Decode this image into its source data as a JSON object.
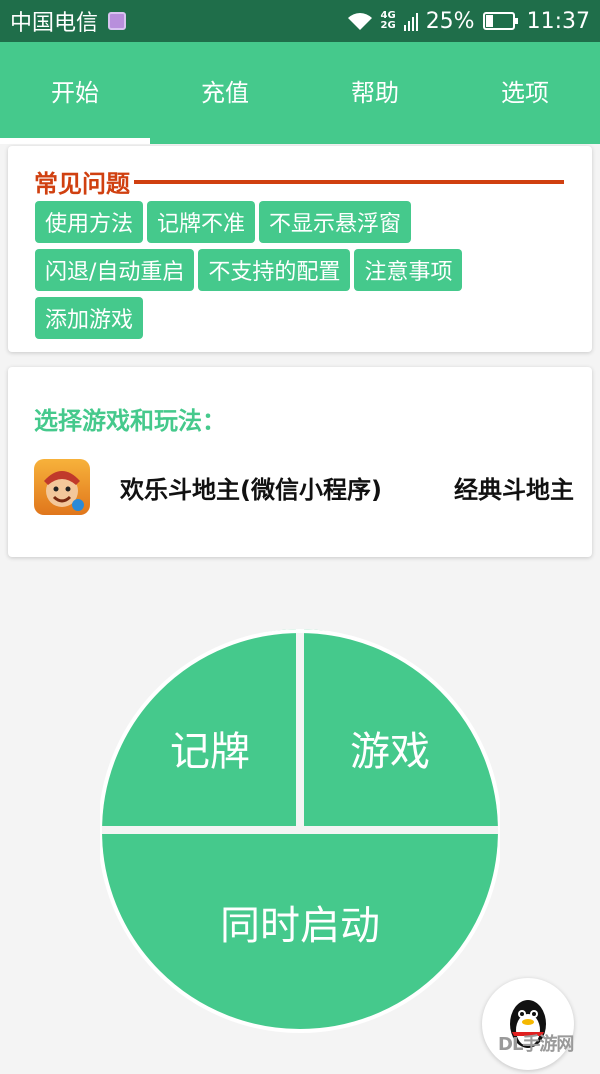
{
  "status_bar": {
    "carrier": "中国电信",
    "network_top": "4G",
    "network_bottom": "2G",
    "battery": "25%",
    "time": "11:37"
  },
  "tabs": [
    {
      "label": "开始",
      "selected": true
    },
    {
      "label": "充值"
    },
    {
      "label": "帮助"
    },
    {
      "label": "选项"
    }
  ],
  "faq": {
    "title": "常见问题",
    "chips": [
      "使用方法",
      "记牌不准",
      "不显示悬浮窗",
      "闪退/自动重启",
      "不支持的配置",
      "注意事项",
      "添加游戏"
    ]
  },
  "game_select": {
    "title": "选择游戏和玩法：",
    "game_name": "欢乐斗地主(微信小程序)",
    "mode": "经典斗地主"
  },
  "actions": {
    "card_counter": "记牌",
    "game": "游戏",
    "launch_both": "同时启动"
  },
  "watermark": "DL手游网",
  "colors": {
    "accent": "#45c98c",
    "status_bar": "#1f6e4a",
    "faq_title": "#d04010"
  }
}
